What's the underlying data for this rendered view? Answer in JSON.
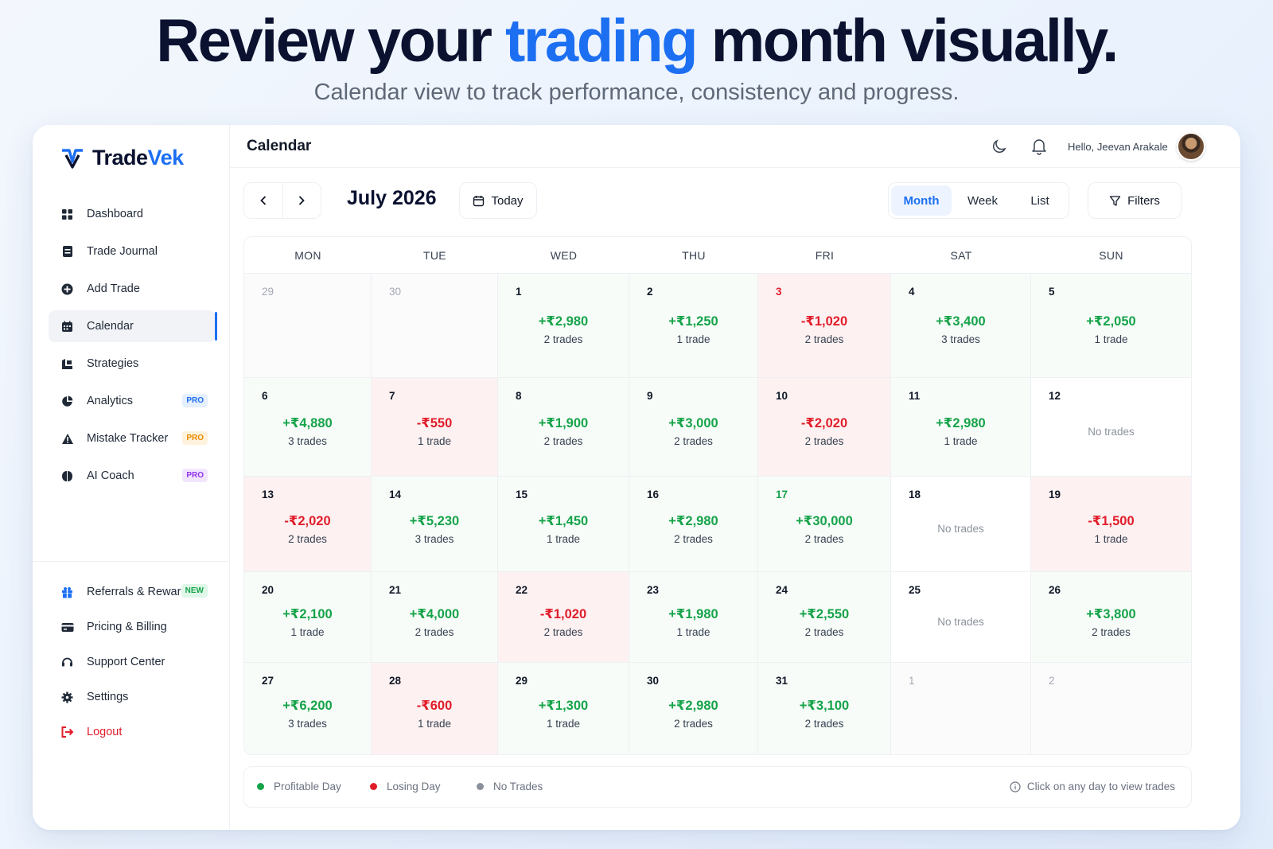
{
  "hero": {
    "title_pre": "Review your ",
    "title_accent": "trading",
    "title_post": " month visually.",
    "subtitle": "Calendar view to track performance, consistency and progress."
  },
  "brand": {
    "name_a": "Trade",
    "name_b": "Vek",
    "accent": "#1d6ff2"
  },
  "sidebar": {
    "items": [
      {
        "label": "Dashboard",
        "icon": "dashboard-grid-icon"
      },
      {
        "label": "Trade Journal",
        "icon": "journal-icon"
      },
      {
        "label": "Add Trade",
        "icon": "plus-circle-icon"
      },
      {
        "label": "Calendar",
        "icon": "calendar-icon",
        "active": true
      },
      {
        "label": "Strategies",
        "icon": "strategy-chart-icon"
      },
      {
        "label": "Analytics",
        "icon": "pie-chart-icon",
        "badge": "PRO"
      },
      {
        "label": "Mistake Tracker",
        "icon": "warning-triangle-icon",
        "badge": "PRO"
      },
      {
        "label": "AI Coach",
        "icon": "brain-icon",
        "badge": "PRO"
      }
    ],
    "bottom_items": [
      {
        "label": "Referrals & Rewards",
        "icon": "gift-icon",
        "badge": "NEW"
      },
      {
        "label": "Pricing & Billing",
        "icon": "credit-card-icon"
      },
      {
        "label": "Support Center",
        "icon": "headset-icon"
      },
      {
        "label": "Settings",
        "icon": "gear-icon"
      },
      {
        "label": "Logout",
        "icon": "logout-icon"
      }
    ]
  },
  "header": {
    "title": "Calendar",
    "greeting": "Hello, Jeevan Arakale"
  },
  "toolbar": {
    "month_label": "July 2026",
    "today_label": "Today",
    "views": [
      "Month",
      "Week",
      "List"
    ],
    "selected_view": "Month",
    "filters_label": "Filters"
  },
  "calendar": {
    "weekdays": [
      "MON",
      "TUE",
      "WED",
      "THU",
      "FRI",
      "SAT",
      "SUN"
    ],
    "weeks": [
      [
        {
          "day": "29",
          "other": true
        },
        {
          "day": "30",
          "other": true
        },
        {
          "day": "1",
          "pnl": "+₹2,980",
          "trades": "2 trades",
          "type": "pos"
        },
        {
          "day": "2",
          "pnl": "+₹1,250",
          "trades": "1 trade",
          "type": "pos"
        },
        {
          "day": "3",
          "pnl": "-₹1,020",
          "trades": "2 trades",
          "type": "neg",
          "day_color": "red"
        },
        {
          "day": "4",
          "pnl": "+₹3,400",
          "trades": "3 trades",
          "type": "pos"
        },
        {
          "day": "5",
          "pnl": "+₹2,050",
          "trades": "1 trade",
          "type": "pos"
        }
      ],
      [
        {
          "day": "6",
          "pnl": "+₹4,880",
          "trades": "3 trades",
          "type": "pos"
        },
        {
          "day": "7",
          "pnl": "-₹550",
          "trades": "1 trade",
          "type": "neg"
        },
        {
          "day": "8",
          "pnl": "+₹1,900",
          "trades": "2 trades",
          "type": "pos"
        },
        {
          "day": "9",
          "pnl": "+₹3,000",
          "trades": "2 trades",
          "type": "pos"
        },
        {
          "day": "10",
          "pnl": "-₹2,020",
          "trades": "2 trades",
          "type": "neg"
        },
        {
          "day": "11",
          "pnl": "+₹2,980",
          "trades": "1 trade",
          "type": "pos"
        },
        {
          "day": "12",
          "no_trades": "No trades",
          "type": "none"
        }
      ],
      [
        {
          "day": "13",
          "pnl": "-₹2,020",
          "trades": "2 trades",
          "type": "neg"
        },
        {
          "day": "14",
          "pnl": "+₹5,230",
          "trades": "3 trades",
          "type": "pos"
        },
        {
          "day": "15",
          "pnl": "+₹1,450",
          "trades": "1 trade",
          "type": "pos"
        },
        {
          "day": "16",
          "pnl": "+₹2,980",
          "trades": "2 trades",
          "type": "pos"
        },
        {
          "day": "17",
          "pnl": "+₹30,000",
          "trades": "2 trades",
          "type": "pos",
          "day_color": "green"
        },
        {
          "day": "18",
          "no_trades": "No trades",
          "type": "none"
        },
        {
          "day": "19",
          "pnl": "-₹1,500",
          "trades": "1 trade",
          "type": "neg"
        }
      ],
      [
        {
          "day": "20",
          "pnl": "+₹2,100",
          "trades": "1 trade",
          "type": "pos"
        },
        {
          "day": "21",
          "pnl": "+₹4,000",
          "trades": "2 trades",
          "type": "pos"
        },
        {
          "day": "22",
          "pnl": "-₹1,020",
          "trades": "2 trades",
          "type": "neg"
        },
        {
          "day": "23",
          "pnl": "+₹1,980",
          "trades": "1 trade",
          "type": "pos"
        },
        {
          "day": "24",
          "pnl": "+₹2,550",
          "trades": "2 trades",
          "type": "pos"
        },
        {
          "day": "25",
          "no_trades": "No trades",
          "type": "none"
        },
        {
          "day": "26",
          "pnl": "+₹3,800",
          "trades": "2 trades",
          "type": "pos"
        }
      ],
      [
        {
          "day": "27",
          "pnl": "+₹6,200",
          "trades": "3 trades",
          "type": "pos"
        },
        {
          "day": "28",
          "pnl": "-₹600",
          "trades": "1 trade",
          "type": "neg"
        },
        {
          "day": "29",
          "pnl": "+₹1,300",
          "trades": "1 trade",
          "type": "pos"
        },
        {
          "day": "30",
          "pnl": "+₹2,980",
          "trades": "2 trades",
          "type": "pos"
        },
        {
          "day": "31",
          "pnl": "+₹3,100",
          "trades": "2 trades",
          "type": "pos"
        },
        {
          "day": "1",
          "other": true
        },
        {
          "day": "2",
          "other": true
        }
      ]
    ]
  },
  "legend": {
    "items": [
      {
        "label": "Profitable Day",
        "color": "#16a34a"
      },
      {
        "label": "Losing Day",
        "color": "#e11d2a"
      },
      {
        "label": "No Trades",
        "color": "#8b919c"
      }
    ],
    "hint": "Click on any day to view trades"
  }
}
